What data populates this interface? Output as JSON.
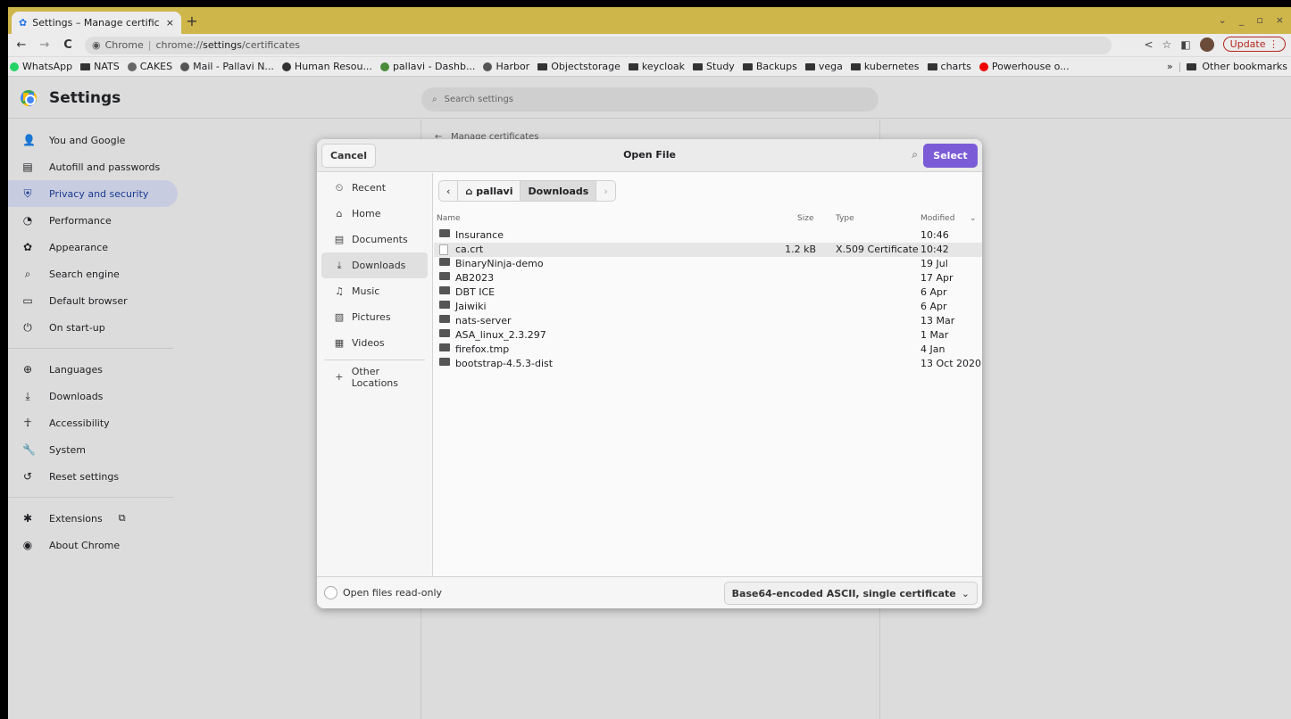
{
  "browser": {
    "tab_title": "Settings – Manage certific",
    "tab_close": "×",
    "new_tab": "+",
    "window_controls": [
      "⌄",
      "_",
      "▫",
      "×"
    ],
    "back": "←",
    "forward": "→",
    "reload": "C",
    "omni_chip": "Chrome",
    "omni_sep": "|",
    "url_prefix": "chrome://",
    "url_host": "settings",
    "url_path": "/certificates",
    "update_label": "Update",
    "update_menu": "⋮"
  },
  "bookmarks": {
    "items": [
      {
        "label": "WhatsApp",
        "icon": "whatsapp-icon"
      },
      {
        "label": "NATS",
        "icon": "folder-icon"
      },
      {
        "label": "CAKES",
        "icon": "cakes-icon"
      },
      {
        "label": "Mail - Pallavi N...",
        "icon": "mail-icon"
      },
      {
        "label": "Human Resou...",
        "icon": "globe-icon"
      },
      {
        "label": "pallavi - Dashb...",
        "icon": "dashboard-icon"
      },
      {
        "label": "Harbor",
        "icon": "harbor-icon"
      },
      {
        "label": "Objectstorage",
        "icon": "folder-icon"
      },
      {
        "label": "keycloak",
        "icon": "folder-icon"
      },
      {
        "label": "Study",
        "icon": "folder-icon"
      },
      {
        "label": "Backups",
        "icon": "folder-icon"
      },
      {
        "label": "vega",
        "icon": "folder-icon"
      },
      {
        "label": "kubernetes",
        "icon": "folder-icon"
      },
      {
        "label": "charts",
        "icon": "folder-icon"
      },
      {
        "label": "Powerhouse o...",
        "icon": "youtube-icon"
      }
    ],
    "overflow": "»",
    "other": "Other bookmarks"
  },
  "settings": {
    "title": "Settings",
    "search_placeholder": "Search settings",
    "manage_certificates": "Manage certificates",
    "sidebar": [
      {
        "label": "You and Google",
        "icon": "👤",
        "active": false
      },
      {
        "label": "Autofill and passwords",
        "icon": "▤",
        "active": false
      },
      {
        "label": "Privacy and security",
        "icon": "⛨",
        "active": true
      },
      {
        "label": "Performance",
        "icon": "◔",
        "active": false
      },
      {
        "label": "Appearance",
        "icon": "✿",
        "active": false
      },
      {
        "label": "Search engine",
        "icon": "⌕",
        "active": false
      },
      {
        "label": "Default browser",
        "icon": "▭",
        "active": false
      },
      {
        "label": "On start-up",
        "icon": "⏻",
        "active": false
      }
    ],
    "sidebar2": [
      {
        "label": "Languages",
        "icon": "⊕"
      },
      {
        "label": "Downloads",
        "icon": "⤓"
      },
      {
        "label": "Accessibility",
        "icon": "☥"
      },
      {
        "label": "System",
        "icon": "🔧"
      },
      {
        "label": "Reset settings",
        "icon": "↺"
      }
    ],
    "sidebar3": [
      {
        "label": "Extensions",
        "icon": "✱",
        "extra": "⧉"
      },
      {
        "label": "About Chrome",
        "icon": "◉",
        "extra": ""
      }
    ]
  },
  "dialog": {
    "title": "Open File",
    "cancel": "Cancel",
    "select": "Select",
    "places": [
      {
        "label": "Recent",
        "icon": "⏲",
        "active": false
      },
      {
        "label": "Home",
        "icon": "⌂",
        "active": false
      },
      {
        "label": "Documents",
        "icon": "▤",
        "active": false
      },
      {
        "label": "Downloads",
        "icon": "⤓",
        "active": true
      },
      {
        "label": "Music",
        "icon": "♫",
        "active": false
      },
      {
        "label": "Pictures",
        "icon": "▧",
        "active": false
      },
      {
        "label": "Videos",
        "icon": "▦",
        "active": false
      }
    ],
    "other_locations": "Other Locations",
    "path": {
      "back": "‹",
      "home": "pallavi",
      "current": "Downloads",
      "forward": "›"
    },
    "columns": {
      "name": "Name",
      "size": "Size",
      "type": "Type",
      "modified": "Modified"
    },
    "files": [
      {
        "name": "Insurance",
        "size": "",
        "type": "",
        "modified": "10:46",
        "kind": "folder",
        "selected": false
      },
      {
        "name": "ca.crt",
        "size": "1.2 kB",
        "type": "X.509 Certificate",
        "modified": "10:42",
        "kind": "file",
        "selected": true
      },
      {
        "name": "BinaryNinja-demo",
        "size": "",
        "type": "",
        "modified": "19 Jul",
        "kind": "folder",
        "selected": false
      },
      {
        "name": "AB2023",
        "size": "",
        "type": "",
        "modified": "17 Apr",
        "kind": "folder",
        "selected": false
      },
      {
        "name": "DBT ICE",
        "size": "",
        "type": "",
        "modified": "6 Apr",
        "kind": "folder",
        "selected": false
      },
      {
        "name": "Jaiwiki",
        "size": "",
        "type": "",
        "modified": "6 Apr",
        "kind": "folder",
        "selected": false
      },
      {
        "name": "nats-server",
        "size": "",
        "type": "",
        "modified": "13 Mar",
        "kind": "folder",
        "selected": false
      },
      {
        "name": "ASA_linux_2.3.297",
        "size": "",
        "type": "",
        "modified": "1 Mar",
        "kind": "folder",
        "selected": false
      },
      {
        "name": "firefox.tmp",
        "size": "",
        "type": "",
        "modified": "4 Jan",
        "kind": "folder",
        "selected": false
      },
      {
        "name": "bootstrap-4.5.3-dist",
        "size": "",
        "type": "",
        "modified": "13 Oct 2020",
        "kind": "folder",
        "selected": false
      }
    ],
    "read_only": "Open files read-only",
    "filter": "Base64-encoded ASCII, single certificate"
  },
  "colors": {
    "accent": "#7b5cd6",
    "tabstrip": "#cfb64a",
    "active_nav": "#c8cce0",
    "update": "#b3261e"
  }
}
